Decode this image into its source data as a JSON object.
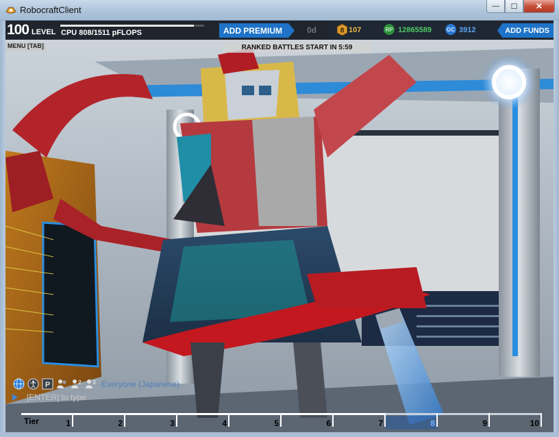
{
  "window": {
    "title": "RobocraftClient",
    "minimize_glyph": "—",
    "maximize_glyph": "☐",
    "close_glyph": "✕"
  },
  "hud": {
    "level": "100",
    "level_label": "LEVEL",
    "xp_progress": 0.93,
    "cpu": "CPU 808/1511 pFLOPS",
    "add_premium": "ADD PREMIUM",
    "premium_days": "0d",
    "tier_value": "107",
    "tier_badge_digit": "8",
    "robits_icon": "RP",
    "robits": "12865589",
    "galaxy_icon": "GC",
    "galaxy_coins": "3912",
    "add_funds": "ADD FUNDS",
    "menu": "MENU [TAB]",
    "ranked_banner": "RANKED BATTLES START IN 5:59",
    "accent_color": "#1e73c8"
  },
  "chat": {
    "icons": [
      "globe-icon",
      "accessibility-icon",
      "p-icon",
      "party-icon",
      "two-person-icon",
      "three-person-icon"
    ],
    "icon_glyphs": {
      "p": "P",
      "two": "2",
      "three": "3"
    },
    "channel": "Everyone (Japanese)",
    "placeholder": "[ENTER] to type"
  },
  "tier_bar": {
    "first_label": "Tier",
    "labels": [
      "1",
      "2",
      "3",
      "4",
      "5",
      "6",
      "7",
      "8",
      "9",
      "10"
    ],
    "current": "8",
    "progress_tier": 7
  }
}
